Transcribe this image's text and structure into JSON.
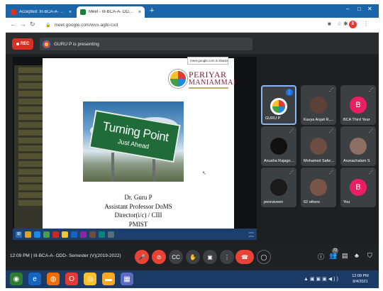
{
  "browser": {
    "tabs": [
      {
        "title": "Accepted: III-BCA-A- ODD- Sem",
        "favicon_color": "#d93025"
      },
      {
        "title": "Meet - III-BCA-A- ODD- Se",
        "favicon_color": "#188038"
      }
    ],
    "new_tab": "+",
    "url": "meet.google.com/wvx-agbi-cxd",
    "profile_initial": "B",
    "window_controls": [
      "–",
      "□"
    ]
  },
  "meet": {
    "rec_label": "REC",
    "presenting_label": "GURU P is presenting",
    "share_tooltip": "meet.google.com is sharing your screen",
    "slide": {
      "logo_top": "PERIYAR",
      "logo_bottom": "MANIAMMAI",
      "sign_main": "Turning Point",
      "sign_sub": "Just Ahead",
      "lines": [
        "Dr. Guru P",
        "Assistant Professor  DoMS",
        "Director(i/c) / CIII",
        "PMIST"
      ]
    },
    "participants": [
      {
        "name": "GURU P",
        "avatar_color": "#ffffff",
        "initial": "",
        "active": true,
        "speaking": true
      },
      {
        "name": "Kavya Anjali R, II...",
        "avatar_color": "#5d4037",
        "initial": "",
        "active": false,
        "speaking": false
      },
      {
        "name": "BCA Third Year",
        "avatar_color": "#e91e63",
        "initial": "B",
        "active": false,
        "speaking": false
      },
      {
        "name": "Anusha Rajagopal",
        "avatar_color": "#111111",
        "initial": "",
        "active": false,
        "speaking": false
      },
      {
        "name": "Mohamed Safwan",
        "avatar_color": "#6d4c41",
        "initial": "",
        "active": false,
        "speaking": false
      },
      {
        "name": "Arunachalam S",
        "avatar_color": "#8d6e63",
        "initial": "",
        "active": false,
        "speaking": false
      },
      {
        "name": "ponnaveen",
        "avatar_color": "#1a1a1a",
        "initial": "",
        "active": false,
        "speaking": false
      },
      {
        "name": "62 others",
        "avatar_color": "#795548",
        "initial": "",
        "active": false,
        "speaking": false
      },
      {
        "name": "You",
        "avatar_color": "#e91e63",
        "initial": "B",
        "active": false,
        "speaking": false
      }
    ],
    "bottom": {
      "time": "12:09 PM",
      "meeting_name": "III-BCA-A- ODD- Semester (V)(2019-2022)",
      "people_count": "72"
    }
  },
  "os": {
    "clock_time": "12:09 PM",
    "clock_date": "8/4/2021"
  }
}
